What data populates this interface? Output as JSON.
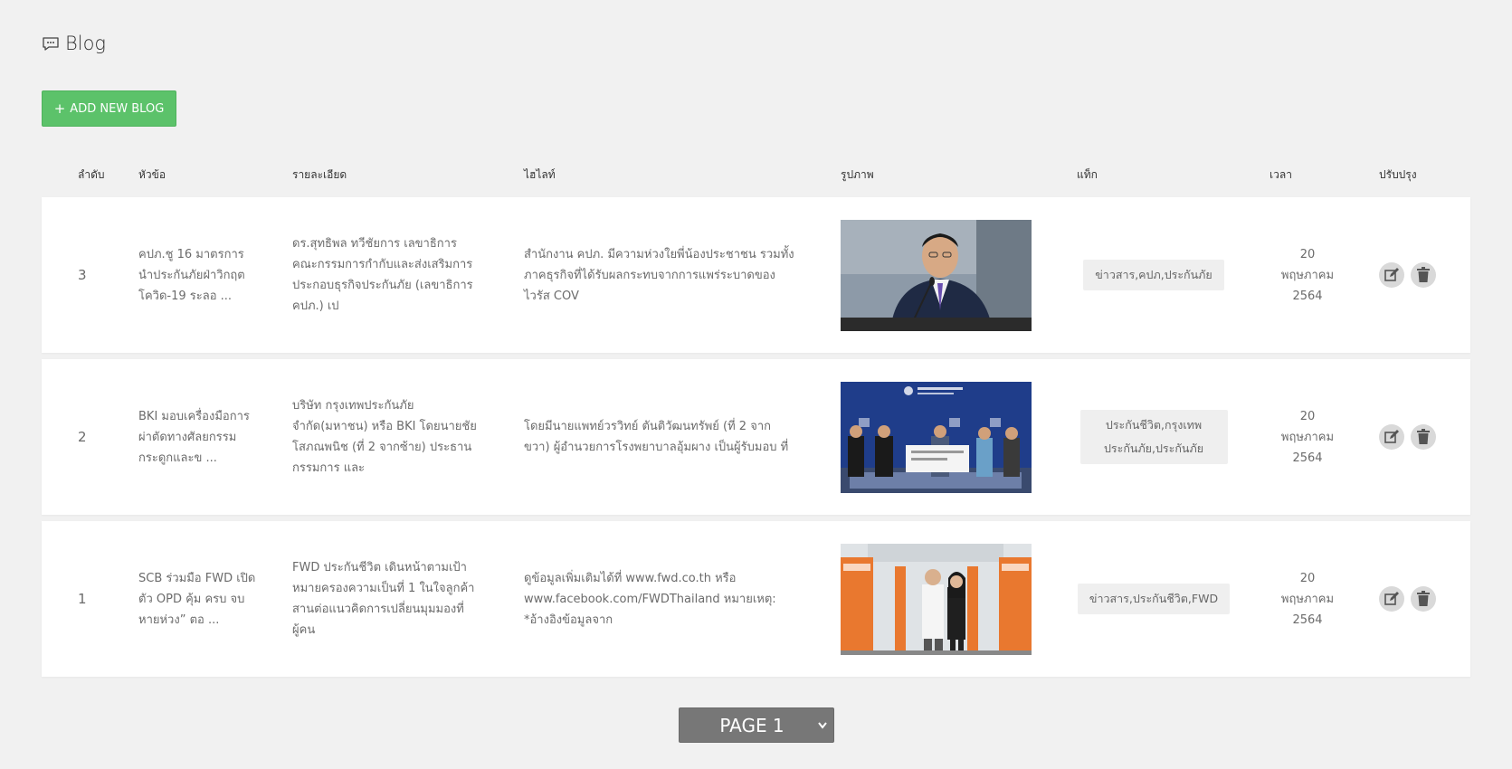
{
  "header": {
    "title": "Blog",
    "icon": "chat-bubble-icon"
  },
  "toolbar": {
    "add_label": "ADD NEW BLOG",
    "add_icon": "plus-icon",
    "add_color": "#5cc26a"
  },
  "table": {
    "columns": [
      "ลำดับ",
      "หัวข้อ",
      "รายละเอียด",
      "ไฮไลท์",
      "รูปภาพ",
      "แท็ก",
      "เวลา",
      "ปรับปรุง"
    ],
    "rows": [
      {
        "num": "3",
        "topic": "คปภ.ชู 16 มาตรการ นำประกันภัยฝ่าวิกฤต โควิด-19 ระลอ ...",
        "detail": "ดร.สุทธิพล ทวีชัยการ เลขาธิการคณะกรรมการกำกับและส่งเสริมการประกอบธุรกิจประกันภัย (เลขาธิการ คปภ.) เป",
        "highlight": "สำนักงาน คปภ. มีความห่วงใยพี่น้องประชาชน รวมทั้งภาคธุรกิจที่ได้รับผลกระทบจากการแพร่ระบาดของไวรัส COV",
        "tag": "ข่าวสาร,คปภ,ประกันภัย",
        "time": [
          "20",
          "พฤษภาคม",
          "2564"
        ]
      },
      {
        "num": "2",
        "topic": "BKI มอบเครื่องมือการผ่าตัดทางศัลยกรรมกระดูกและข ...",
        "detail": "บริษัท กรุงเทพประกันภัย จำกัด(มหาชน) หรือ BKI โดยนายชัย โสภณพนิช (ที่ 2 จากซ้าย) ประธานกรรมการ และ",
        "highlight": "โดยมีนายแพทย์วรวิทย์ ตันติวัฒนทรัพย์ (ที่ 2 จากขวา) ผู้อำนวยการโรงพยาบาลอุ้มผาง เป็นผู้รับมอบ ที่",
        "tag": "ประกันชีวิต,กรุงเทพประกันภัย,ประกันภัย",
        "time": [
          "20",
          "พฤษภาคม",
          "2564"
        ]
      },
      {
        "num": "1",
        "topic": "SCB ร่วมมือ FWD เปิดตัว OPD คุ้ม ครบ จบหายห่วง” ตอ ...",
        "detail": "FWD ประกันชีวิต เดินหน้าตามเป้าหมายครองความเป็นที่ 1 ในใจลูกค้า สานต่อแนวคิดการเปลี่ยนมุมมองที่ผู้คน",
        "highlight": "ดูข้อมูลเพิ่มเติมได้ที่ www.fwd.co.th หรือ www.facebook.com/FWDThailand หมายเหตุ: *อ้างอิงข้อมูลจาก",
        "tag": "ข่าวสาร,ประกันชีวิต,FWD",
        "time": [
          "20",
          "พฤษภาคม",
          "2564"
        ]
      }
    ]
  },
  "pagination": {
    "selected": "PAGE 1"
  }
}
